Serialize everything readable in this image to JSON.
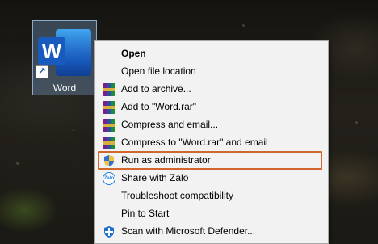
{
  "desktop": {
    "icon_label": "Word",
    "logo_letter": "W"
  },
  "context_menu": {
    "items": [
      {
        "label": "Open",
        "bold": true,
        "icon": "none"
      },
      {
        "label": "Open file location",
        "icon": "none"
      },
      {
        "label": "Add to archive...",
        "icon": "winrar-icon"
      },
      {
        "label": "Add to \"Word.rar\"",
        "icon": "winrar-icon"
      },
      {
        "label": "Compress and email...",
        "icon": "winrar-icon"
      },
      {
        "label": "Compress to \"Word.rar\" and email",
        "icon": "winrar-icon"
      },
      {
        "label": "Run as administrator",
        "icon": "uac-shield-icon",
        "highlighted": true
      },
      {
        "label": "Share with Zalo",
        "icon": "zalo-icon"
      },
      {
        "label": "Troubleshoot compatibility",
        "icon": "none"
      },
      {
        "label": "Pin to Start",
        "icon": "none"
      },
      {
        "label": "Scan with Microsoft Defender...",
        "icon": "defender-icon"
      }
    ]
  },
  "colors": {
    "highlight_border": "#d2672e",
    "menu_bg": "#f2f2f2",
    "word_blue": "#185abd"
  }
}
